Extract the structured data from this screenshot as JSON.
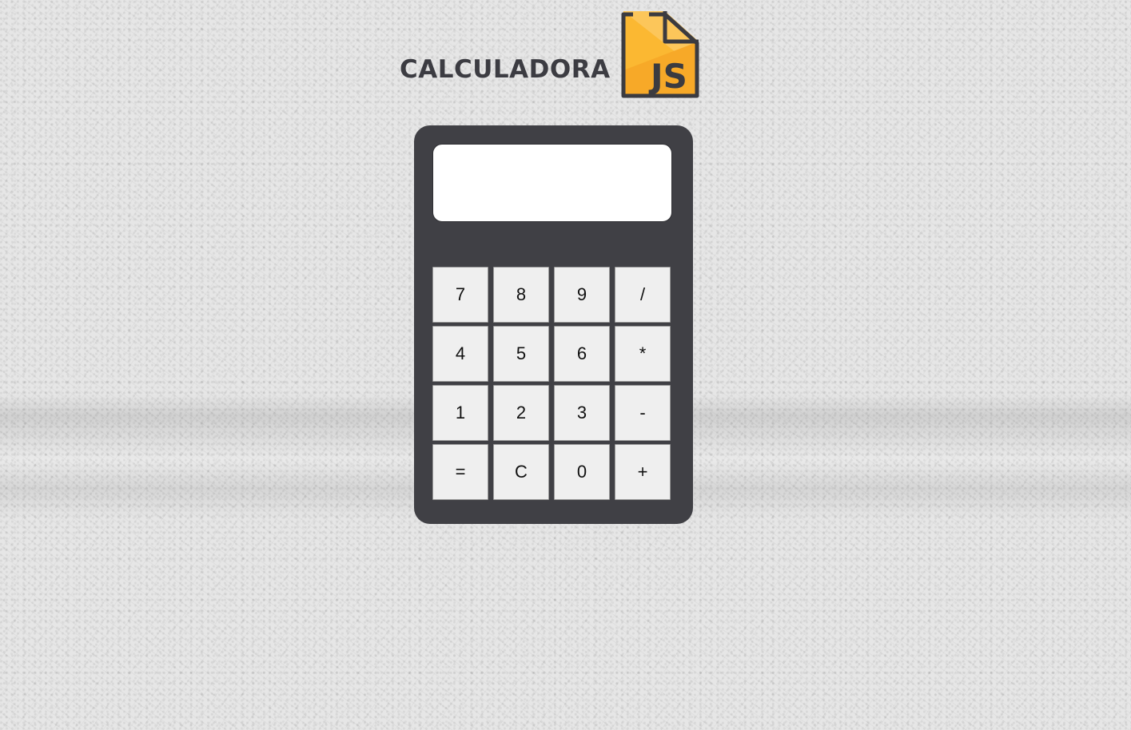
{
  "header": {
    "title": "CALCULADORA",
    "logo_icon": "js-file-icon",
    "logo_badge": "JS",
    "logo_color": "#fbb832"
  },
  "calculator": {
    "display_value": "",
    "body_color": "#404045",
    "keys": [
      "7",
      "8",
      "9",
      "/",
      "4",
      "5",
      "6",
      "*",
      "1",
      "2",
      "3",
      "-",
      "=",
      "C",
      "0",
      "+"
    ]
  }
}
